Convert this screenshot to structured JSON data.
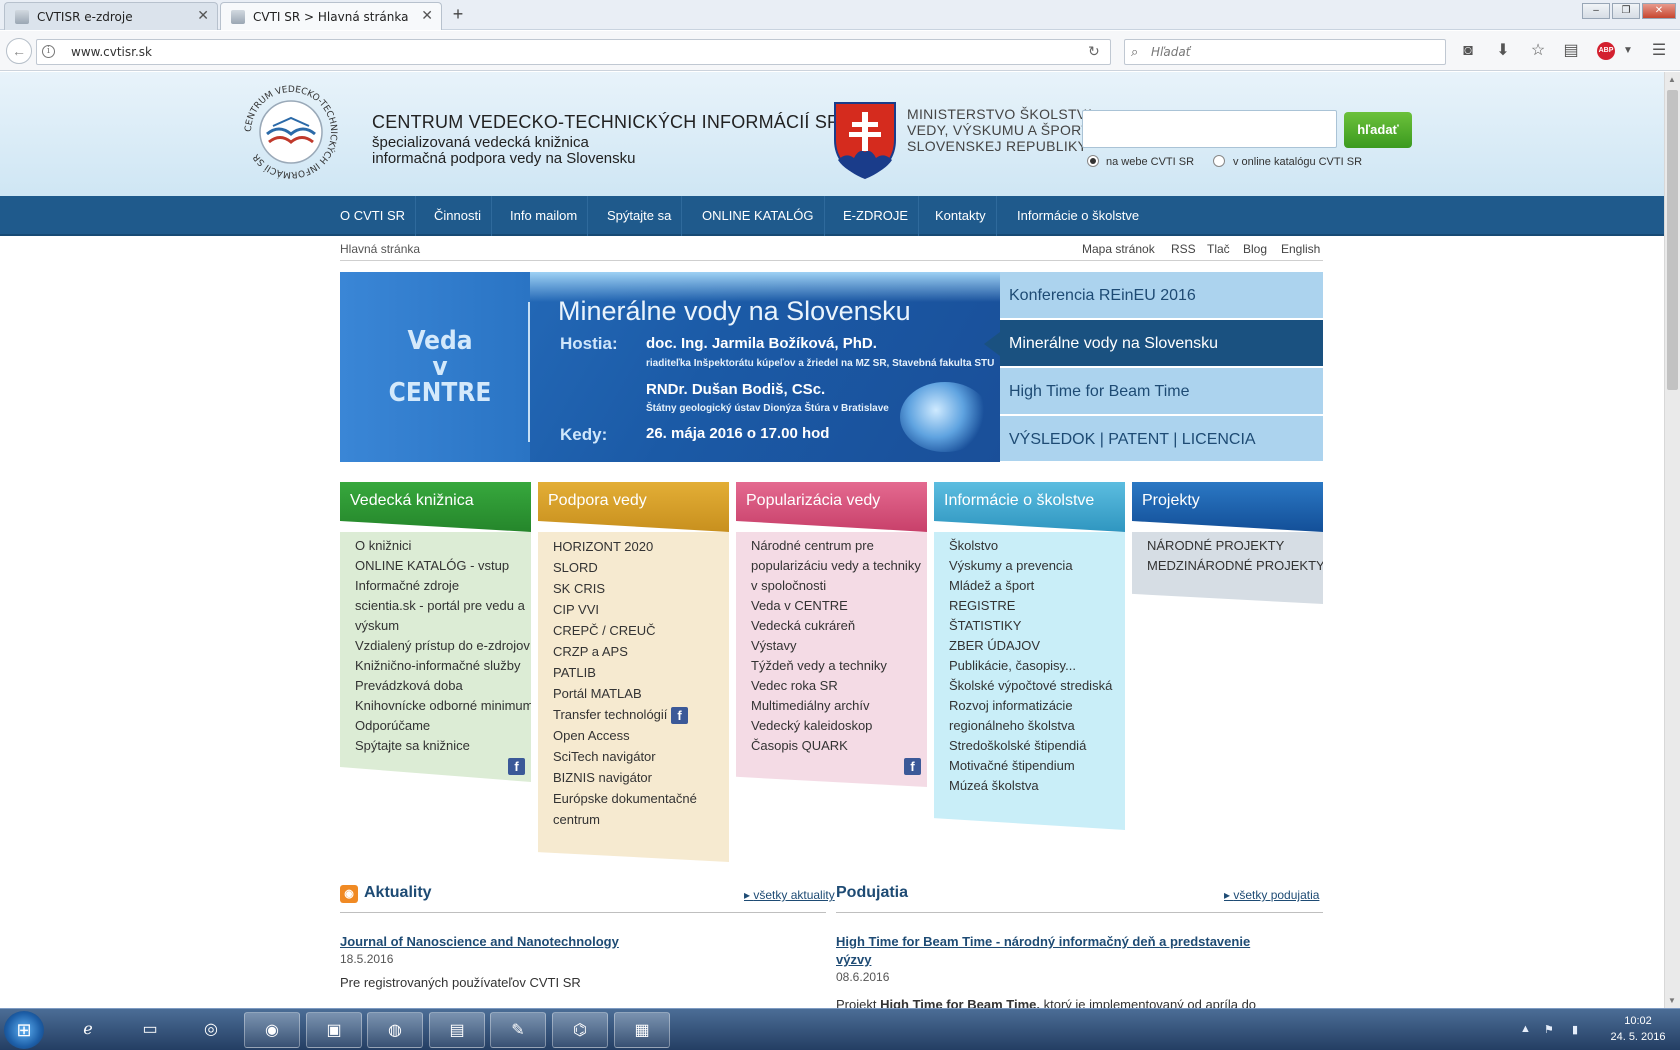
{
  "browser": {
    "tabs": [
      {
        "title": "CVTISR e-zdroje",
        "active": false
      },
      {
        "title": "CVTI SR > Hlavná stránka",
        "active": true
      }
    ],
    "url": "www.cvtisr.sk",
    "search_placeholder": "Hľadať",
    "abp_badge": "ABP"
  },
  "header": {
    "org_name": "CENTRUM VEDECKO-TECHNICKÝCH INFORMÁCIÍ SR",
    "org_sub1": "špecializovaná vedecká knižnica",
    "org_sub2": "informačná podpora vedy na Slovensku",
    "logo_ring_text": "CENTRUM VEDECKO-TECHNICKÝCH INFORMÁCIÍ SR",
    "ministry": [
      "MINISTERSTVO ŠKOLSTVA,",
      "VEDY, VÝSKUMU A ŠPORTU",
      "SLOVENSKEJ REPUBLIKY"
    ],
    "search_button": "hľadať",
    "radio1": "na webe CVTI SR",
    "radio2": "v online katalógu CVTI SR"
  },
  "nav": [
    "O CVTI SR",
    "Činnosti",
    "Info mailom",
    "Spýtajte sa",
    "ONLINE KATALÓG",
    "E-ZDROJE",
    "Kontakty",
    "Informácie o školstve"
  ],
  "breadcrumb": "Hlavná stránka",
  "toplinks": [
    "Mapa stránok",
    "RSS",
    "Tlač",
    "Blog",
    "English"
  ],
  "banner": {
    "veda_lines": [
      "Veda",
      "v",
      "CENTRE"
    ],
    "title": "Minerálne vody na Slovensku",
    "hostia_label": "Hostia:",
    "guest1": "doc. Ing. Jarmila Božíková, PhD.",
    "guest1_role": "riaditeľka Inšpektorátu kúpeľov a žriedel na MZ SR, Stavebná fakulta STU",
    "guest2": "RNDr. Dušan Bodiš, CSc.",
    "guest2_role": "Štátny geologický ústav Dionýza Štúra v Bratislave",
    "kedy_label": "Kedy:",
    "when": "26. mája 2016 o 17.00 hod"
  },
  "slides": [
    "Konferencia REinEU 2016",
    "Minerálne vody na Slovensku",
    "High Time for Beam Time",
    "VÝSLEDOK | PATENT | LICENCIA"
  ],
  "columns": [
    {
      "title": "Vedecká knižnica",
      "color": "#2f9a36",
      "bg": "#dcecd5",
      "items": [
        "O knižnici",
        "ONLINE KATALÓG - vstup",
        "Informačné zdroje",
        "scientia.sk - portál pre vedu a",
        "výskum",
        "Vzdialený prístup do e-zdrojov",
        "Knižnično-informačné služby",
        "Prevádzková doba",
        "Knihovnícke odborné minimum",
        "Odporúčame",
        "Spýtajte sa knižnice"
      ]
    },
    {
      "title": "Podpora vedy",
      "color": "#d9a12b",
      "bg": "#f6ead0",
      "items": [
        "HORIZONT 2020",
        "SLORD",
        "SK CRIS",
        "CIP VVI",
        "CREPČ / CREUČ",
        "CRZP a APS",
        "PATLIB",
        "Portál MATLAB",
        "Transfer technológií",
        "Open Access",
        "SciTech navigátor",
        "BIZNIS navigátor",
        "Európske dokumentačné",
        "centrum"
      ]
    },
    {
      "title": "Popularizácia vedy",
      "color": "#d8547e",
      "bg": "#f4dbe5",
      "items": [
        "Národné centrum pre",
        "popularizáciu vedy a techniky",
        "v spoločnosti",
        "Veda v CENTRE",
        "Vedecká cukráreň",
        "Výstavy",
        "Týždeň vedy a techniky",
        "Vedec roka SR",
        "Multimediálny archív",
        "Vedecký kaleidoskop",
        "Časopis QUARK"
      ]
    },
    {
      "title": "Informácie o školstve",
      "color": "#3fa9cf",
      "bg": "#c9eef8",
      "items": [
        "Školstvo",
        "Výskumy a prevencia",
        "Mládež a šport",
        "REGISTRE",
        "ŠTATISTIKY",
        "ZBER ÚDAJOV",
        "Publikácie, časopisy...",
        "Školské výpočtové strediská",
        "Rozvoj informatizácie",
        "regionálneho školstva",
        "Stredoškolské štipendiá",
        "Motivačné štipendium",
        "Múzeá školstva"
      ]
    },
    {
      "title": "Projekty",
      "color": "#1d63b0",
      "bg": "#d6dde4",
      "items": [
        "NÁRODNÉ PROJEKTY",
        "MEDZINÁRODNÉ PROJEKTY"
      ]
    }
  ],
  "news": {
    "title": "Aktuality",
    "more": "všetky aktuality",
    "item_title": "Journal of Nanoscience and Nanotechnology",
    "item_date": "18.5.2016",
    "item_text": "Pre registrovaných používateľov CVTI SR"
  },
  "events": {
    "title": "Podujatia",
    "more": "všetky podujatia",
    "item_title1": "High Time for Beam Time - národný informačný deň a predstavenie",
    "item_title2": "výzvy",
    "item_date": "08.6.2016",
    "item_text_pre": "Projekt ",
    "item_text_bold": "High Time for Beam Time,",
    "item_text_post": " ktorý je implementovaný od apríla do"
  },
  "taskbar": {
    "time": "10:02",
    "date": "24. 5. 2016"
  }
}
